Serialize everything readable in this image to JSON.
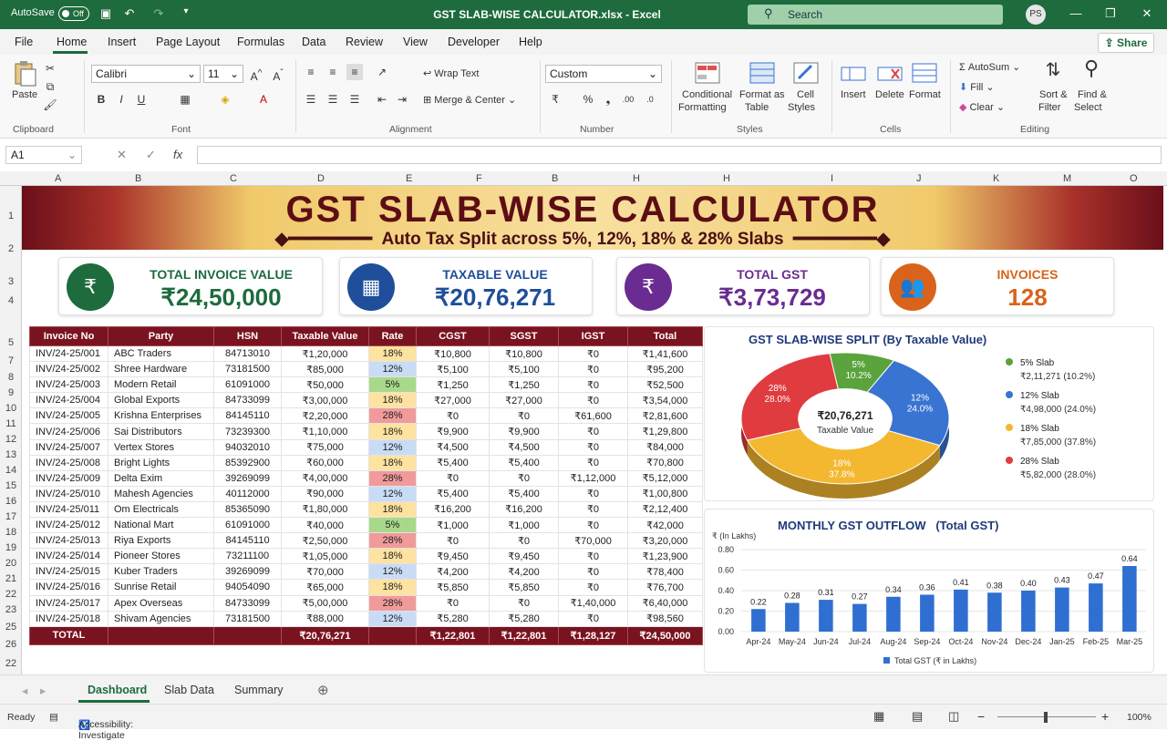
{
  "titlebar": {
    "autosave": "AutoSave",
    "toggle": "Off",
    "document_title": "GST SLAB-WISE CALCULATOR.xlsx - Excel",
    "search": "Search",
    "user_initials": "PS"
  },
  "menu": {
    "items": [
      "File",
      "Home",
      "Insert",
      "Page Layout",
      "Formulas",
      "Data",
      "Review",
      "View",
      "Developer",
      "Help"
    ],
    "share": "Share"
  },
  "ribbon": {
    "paste": "Paste",
    "clipboard": "Clipboard",
    "font_name": "Calibri",
    "font_size": "11",
    "font_group": "Font",
    "wrap_text": "Wrap Text",
    "merge_center": "Merge & Center",
    "alignment_group": "Alignment",
    "number_format": "Custom",
    "number_group": "Number",
    "conditional_1": "Conditional",
    "conditional_2": "Formatting",
    "format_table_1": "Format as",
    "format_table_2": "Table",
    "cell_styles_1": "Cell",
    "cell_styles_2": "Styles",
    "styles_group": "Styles",
    "insert": "Insert",
    "delete": "Delete",
    "format": "Format",
    "cells_group": "Cells",
    "autosum": "AutoSum",
    "fill": "Fill",
    "clear": "Clear",
    "sort_1": "Sort &",
    "sort_2": "Filter",
    "find_1": "Find &",
    "find_2": "Select",
    "editing_group": "Editing"
  },
  "formula": {
    "name_box": "A1",
    "fx": "fx"
  },
  "columns": [
    "A",
    "B",
    "C",
    "D",
    "E",
    "F",
    "B",
    "H",
    "H",
    "I",
    "J",
    "K",
    "M",
    "O"
  ],
  "rows": [
    "1",
    "2",
    "3",
    "4",
    "5",
    "7",
    "8",
    "9",
    "10",
    "11",
    "12",
    "13",
    "14",
    "15",
    "16",
    "17",
    "18",
    "19",
    "20",
    "21",
    "22",
    "23",
    "25",
    "26",
    "22"
  ],
  "banner": {
    "title": "GST SLAB-WISE CALCULATOR",
    "subtitle": "Auto Tax Split across 5%, 12%, 18% & 28% Slabs"
  },
  "kpis": [
    {
      "label": "TOTAL INVOICE VALUE",
      "value": "₹24,50,000",
      "color": "#1e6b3d",
      "icon": "invoice-rupee-icon"
    },
    {
      "label": "TAXABLE VALUE",
      "value": "₹20,76,271",
      "color": "#1f4e9a",
      "icon": "calculator-icon"
    },
    {
      "label": "TOTAL GST",
      "value": "₹3,73,729",
      "color": "#6a2c91",
      "icon": "coins-rupee-icon"
    },
    {
      "label": "INVOICES",
      "value": "128",
      "color": "#d9631a",
      "icon": "people-icon"
    }
  ],
  "table": {
    "headers": [
      "Invoice No",
      "Party",
      "HSN",
      "Taxable Value",
      "Rate",
      "CGST",
      "SGST",
      "IGST",
      "Total"
    ],
    "rows": [
      [
        "INV/24-25/001",
        "ABC Traders",
        "84713010",
        "₹1,20,000",
        "18%",
        "₹10,800",
        "₹10,800",
        "₹0",
        "₹1,41,600"
      ],
      [
        "INV/24-25/002",
        "Shree Hardware",
        "73181500",
        "₹85,000",
        "12%",
        "₹5,100",
        "₹5,100",
        "₹0",
        "₹95,200"
      ],
      [
        "INV/24-25/003",
        "Modern Retail",
        "61091000",
        "₹50,000",
        "5%",
        "₹1,250",
        "₹1,250",
        "₹0",
        "₹52,500"
      ],
      [
        "INV/24-25/004",
        "Global Exports",
        "84733099",
        "₹3,00,000",
        "18%",
        "₹27,000",
        "₹27,000",
        "₹0",
        "₹3,54,000"
      ],
      [
        "INV/24-25/005",
        "Krishna Enterprises",
        "84145110",
        "₹2,20,000",
        "28%",
        "₹0",
        "₹0",
        "₹61,600",
        "₹2,81,600"
      ],
      [
        "INV/24-25/006",
        "Sai Distributors",
        "73239300",
        "₹1,10,000",
        "18%",
        "₹9,900",
        "₹9,900",
        "₹0",
        "₹1,29,800"
      ],
      [
        "INV/24-25/007",
        "Vertex Stores",
        "94032010",
        "₹75,000",
        "12%",
        "₹4,500",
        "₹4,500",
        "₹0",
        "₹84,000"
      ],
      [
        "INV/24-25/008",
        "Bright Lights",
        "85392900",
        "₹60,000",
        "18%",
        "₹5,400",
        "₹5,400",
        "₹0",
        "₹70,800"
      ],
      [
        "INV/24-25/009",
        "Delta Exim",
        "39269099",
        "₹4,00,000",
        "28%",
        "₹0",
        "₹0",
        "₹1,12,000",
        "₹5,12,000"
      ],
      [
        "INV/24-25/010",
        "Mahesh Agencies",
        "40112000",
        "₹90,000",
        "12%",
        "₹5,400",
        "₹5,400",
        "₹0",
        "₹1,00,800"
      ],
      [
        "INV/24-25/011",
        "Om Electricals",
        "85365090",
        "₹1,80,000",
        "18%",
        "₹16,200",
        "₹16,200",
        "₹0",
        "₹2,12,400"
      ],
      [
        "INV/24-25/012",
        "National Mart",
        "61091000",
        "₹40,000",
        "5%",
        "₹1,000",
        "₹1,000",
        "₹0",
        "₹42,000"
      ],
      [
        "INV/24-25/013",
        "Riya Exports",
        "84145110",
        "₹2,50,000",
        "28%",
        "₹0",
        "₹0",
        "₹70,000",
        "₹3,20,000"
      ],
      [
        "INV/24-25/014",
        "Pioneer Stores",
        "73211100",
        "₹1,05,000",
        "18%",
        "₹9,450",
        "₹9,450",
        "₹0",
        "₹1,23,900"
      ],
      [
        "INV/24-25/015",
        "Kuber Traders",
        "39269099",
        "₹70,000",
        "12%",
        "₹4,200",
        "₹4,200",
        "₹0",
        "₹78,400"
      ],
      [
        "INV/24-25/016",
        "Sunrise Retail",
        "94054090",
        "₹65,000",
        "18%",
        "₹5,850",
        "₹5,850",
        "₹0",
        "₹76,700"
      ],
      [
        "INV/24-25/017",
        "Apex Overseas",
        "84733099",
        "₹5,00,000",
        "28%",
        "₹0",
        "₹0",
        "₹1,40,000",
        "₹6,40,000"
      ],
      [
        "INV/24-25/018",
        "Shivam Agencies",
        "73181500",
        "₹88,000",
        "12%",
        "₹5,280",
        "₹5,280",
        "₹0",
        "₹98,560"
      ]
    ],
    "total": [
      "TOTAL",
      "",
      "",
      "₹20,76,271",
      "",
      "₹1,22,801",
      "₹1,22,801",
      "₹1,28,127",
      "₹24,50,000"
    ]
  },
  "pie": {
    "title": "GST SLAB-WISE SPLIT (By Taxable Value)",
    "center_value": "₹20,76,271",
    "center_label": "Taxable Value",
    "slices": [
      {
        "name": "5% Slab",
        "inner_top": "5%",
        "inner_bot": "10.2%",
        "value": 211271,
        "display": "₹2,11,271 (10.2%)",
        "color": "#5aa33d"
      },
      {
        "name": "12% Slab",
        "inner_top": "12%",
        "inner_bot": "24.0%",
        "value": 498000,
        "display": "₹4,98,000 (24.0%)",
        "color": "#3a74d2"
      },
      {
        "name": "18% Slab",
        "inner_top": "18%",
        "inner_bot": "37.8%",
        "value": 785000,
        "display": "₹7,85,000 (37.8%)",
        "color": "#f4b830"
      },
      {
        "name": "28% Slab",
        "inner_top": "28%",
        "inner_bot": "28.0%",
        "value": 582000,
        "display": "₹5,82,000 (28.0%)",
        "color": "#e03b3f"
      }
    ]
  },
  "bar": {
    "title": "MONTHLY GST OUTFLOW   (Total GST)",
    "ylabel": "₹ (In Lakhs)",
    "yticks": [
      "0.80",
      "0.60",
      "0.40",
      "0.20",
      "0.00"
    ],
    "legend": "Total GST (₹ in Lakhs)",
    "color": "#2f6fd1"
  },
  "chart_data": [
    {
      "type": "pie",
      "title": "GST SLAB-WISE SPLIT (By Taxable Value)",
      "categories": [
        "5% Slab",
        "12% Slab",
        "18% Slab",
        "28% Slab"
      ],
      "values": [
        211271,
        498000,
        785000,
        582000
      ]
    },
    {
      "type": "bar",
      "title": "MONTHLY GST OUTFLOW   (Total GST)",
      "ylabel": "₹ (In Lakhs)",
      "ylim": [
        0,
        0.8
      ],
      "legend": "Total GST (₹ in Lakhs)",
      "categories": [
        "Apr-24",
        "May-24",
        "Jun-24",
        "Jul-24",
        "Aug-24",
        "Sep-24",
        "Oct-24",
        "Nov-24",
        "Dec-24",
        "Jan-25",
        "Feb-25",
        "Mar-25"
      ],
      "values": [
        0.22,
        0.28,
        0.31,
        0.27,
        0.34,
        0.36,
        0.41,
        0.38,
        0.4,
        0.43,
        0.47,
        0.64
      ]
    }
  ],
  "tabs": [
    "Dashboard",
    "Slab Data",
    "Summary"
  ],
  "status": {
    "ready": "Ready",
    "accessibility": "Accessibility: Investigate",
    "zoom": "100%"
  }
}
